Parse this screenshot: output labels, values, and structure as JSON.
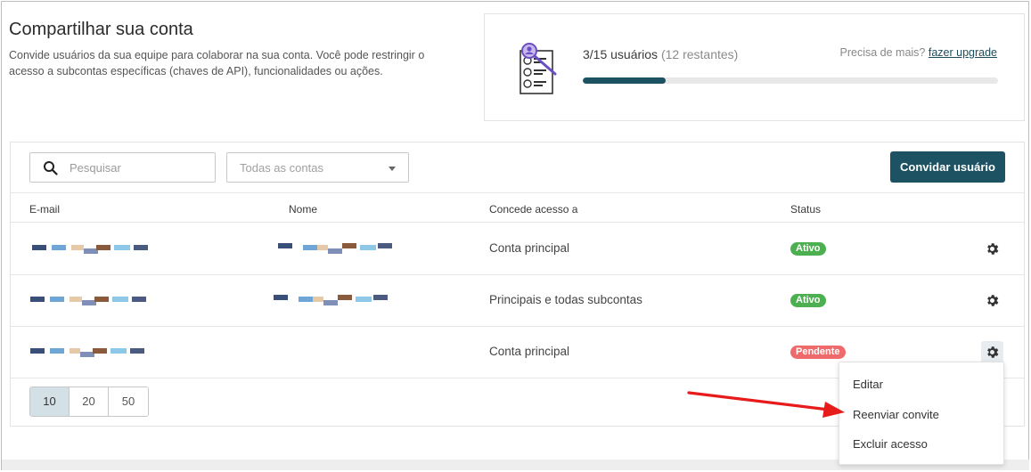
{
  "header": {
    "title": "Compartilhar sua conta",
    "description": "Convide usuários da sua equipe para colaborar na sua conta. Você pode restringir o acesso a subcontas específicas (chaves de API), funcionalidades ou ações."
  },
  "usage": {
    "count": "3/15 usuários",
    "remaining": "(12 restantes)",
    "used": 3,
    "limit": 15,
    "need_more": "Precisa de mais?",
    "upgrade_link": "fazer upgrade"
  },
  "toolbar": {
    "search_placeholder": "Pesquisar",
    "accounts_filter": "Todas as contas",
    "invite_button": "Convidar usuário"
  },
  "table": {
    "columns": [
      "E-mail",
      "Nome",
      "Concede acesso a",
      "Status"
    ],
    "rows": [
      {
        "access": "Conta principal",
        "status": "Ativo"
      },
      {
        "access": "Principais e todas subcontas",
        "status": "Ativo"
      },
      {
        "access": "Conta principal",
        "status": "Pendente"
      }
    ]
  },
  "pagination": {
    "page_sizes": [
      "10",
      "20",
      "50"
    ],
    "selected": "10"
  },
  "context_menu": {
    "items": [
      "Editar",
      "Reenviar convite",
      "Excluir acesso"
    ]
  },
  "colors": {
    "primary": "#1d5262",
    "active": "#4caf50",
    "pending": "#ef6b6b",
    "annotation_arrow": "#e81b1b"
  }
}
